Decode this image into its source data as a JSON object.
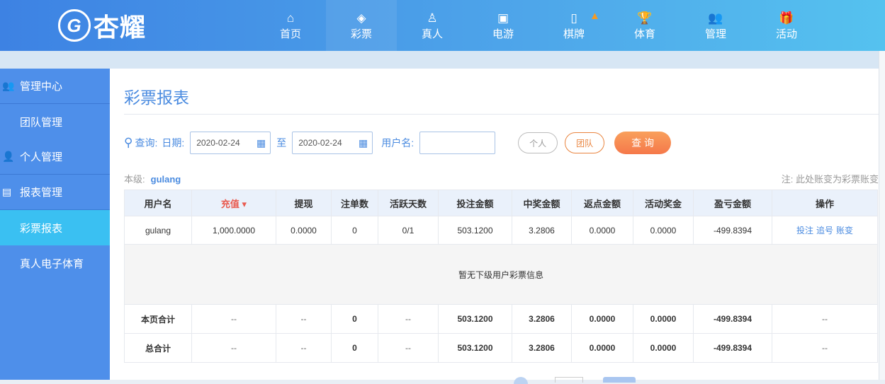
{
  "brand": {
    "name": "杏耀",
    "crest": "G"
  },
  "nav": [
    {
      "label": "首页",
      "icon": "home-icon",
      "glyph": "⌂"
    },
    {
      "label": "彩票",
      "icon": "lottery-icon",
      "glyph": "◈"
    },
    {
      "label": "真人",
      "icon": "live-dealer-icon",
      "glyph": "♙"
    },
    {
      "label": "电游",
      "icon": "slot-machine-icon",
      "glyph": "▣"
    },
    {
      "label": "棋牌",
      "icon": "mahjong-icon",
      "glyph": "▯"
    },
    {
      "label": "体育",
      "icon": "trophy-icon",
      "glyph": "🏆"
    },
    {
      "label": "管理",
      "icon": "users-icon",
      "glyph": "👥"
    },
    {
      "label": "活动",
      "icon": "gift-icon",
      "glyph": "🎁"
    }
  ],
  "sidebar": [
    {
      "label": "管理中心",
      "group": true,
      "glyph": "👥"
    },
    {
      "label": "团队管理"
    },
    {
      "label": "个人管理",
      "group": true,
      "glyph": "👤"
    },
    {
      "label": "报表管理",
      "group": true,
      "glyph": "▤"
    },
    {
      "label": "彩票报表",
      "active": true
    },
    {
      "label": "真人电子体育"
    }
  ],
  "page": {
    "title": "彩票报表"
  },
  "filter": {
    "query_label": "查询:",
    "date_label": "日期:",
    "date_from": "2020-02-24",
    "to_label": "至",
    "date_to": "2020-02-24",
    "username_label": "用户名:",
    "username_value": "",
    "personal": "个人",
    "team": "团队",
    "search": "查 询"
  },
  "level": {
    "label": "本级:",
    "user": "gulang"
  },
  "note": "注: 此处账变为彩票账变",
  "table": {
    "headers": [
      "用户名",
      "充值 ▾",
      "提现",
      "注单数",
      "活跃天数",
      "投注金额",
      "中奖金额",
      "返点金额",
      "活动奖金",
      "盈亏金额",
      "操作"
    ],
    "row": [
      "gulang",
      "1,000.0000",
      "0.0000",
      "0",
      "0/1",
      "503.1200",
      "3.2806",
      "0.0000",
      "0.0000",
      "-499.8394"
    ],
    "actions": [
      "投注",
      "追号",
      "账变"
    ],
    "empty": "暂无下级用户彩票信息",
    "page_total": [
      "本页合计",
      "--",
      "--",
      "0",
      "--",
      "503.1200",
      "3.2806",
      "0.0000",
      "0.0000",
      "-499.8394",
      "--"
    ],
    "grand_total": [
      "总合计",
      "--",
      "--",
      "0",
      "--",
      "503.1200",
      "3.2806",
      "0.0000",
      "0.0000",
      "-499.8394",
      "--"
    ]
  },
  "colors": {
    "accent": "#4a8be0",
    "negative": "#e02020",
    "search": "#f7874f",
    "team": "#e9843e"
  }
}
